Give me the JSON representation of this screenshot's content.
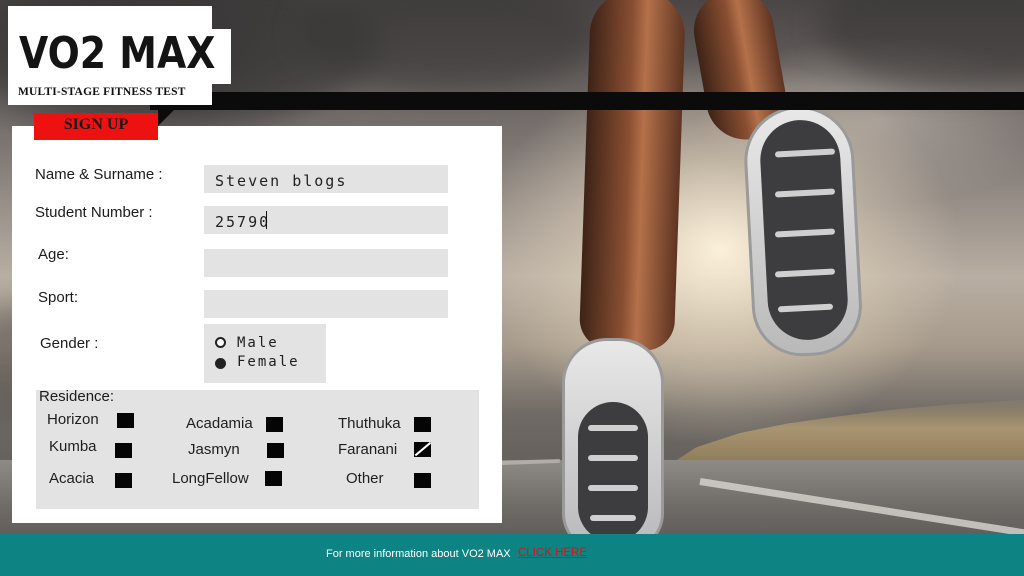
{
  "logo": {
    "title": "VO2 MAX",
    "subtitle": "MULTI-STAGE FITNESS TEST"
  },
  "signup_tab": {
    "label": "SIGN UP"
  },
  "form": {
    "name": {
      "label": "Name & Surname :",
      "value": "Steven blogs"
    },
    "student_number": {
      "label": "Student Number :",
      "value": "25790"
    },
    "age": {
      "label": "Age:",
      "value": ""
    },
    "sport": {
      "label": "Sport:",
      "value": ""
    },
    "gender": {
      "label": "Gender :",
      "options": [
        {
          "label": "Male",
          "selected": false
        },
        {
          "label": "Female",
          "selected": true
        }
      ]
    },
    "residence": {
      "title": "Residence:",
      "options": [
        {
          "label": "Horizon",
          "checked": false
        },
        {
          "label": "Acadamia",
          "checked": false
        },
        {
          "label": "Thuthuka",
          "checked": false
        },
        {
          "label": "Kumba",
          "checked": false
        },
        {
          "label": "Jasmyn",
          "checked": false
        },
        {
          "label": "Faranani",
          "checked": true
        },
        {
          "label": "Acacia",
          "checked": false
        },
        {
          "label": "LongFellow",
          "checked": false
        },
        {
          "label": "Other",
          "checked": false
        }
      ]
    }
  },
  "footer": {
    "text": "For more information about VO2 MAX",
    "link": "CLICK HERE"
  },
  "colors": {
    "footer_bg": "#0d8383",
    "signup_red": "#ee1111",
    "link_red": "#d61616",
    "field_gray": "#e3e3e3"
  }
}
